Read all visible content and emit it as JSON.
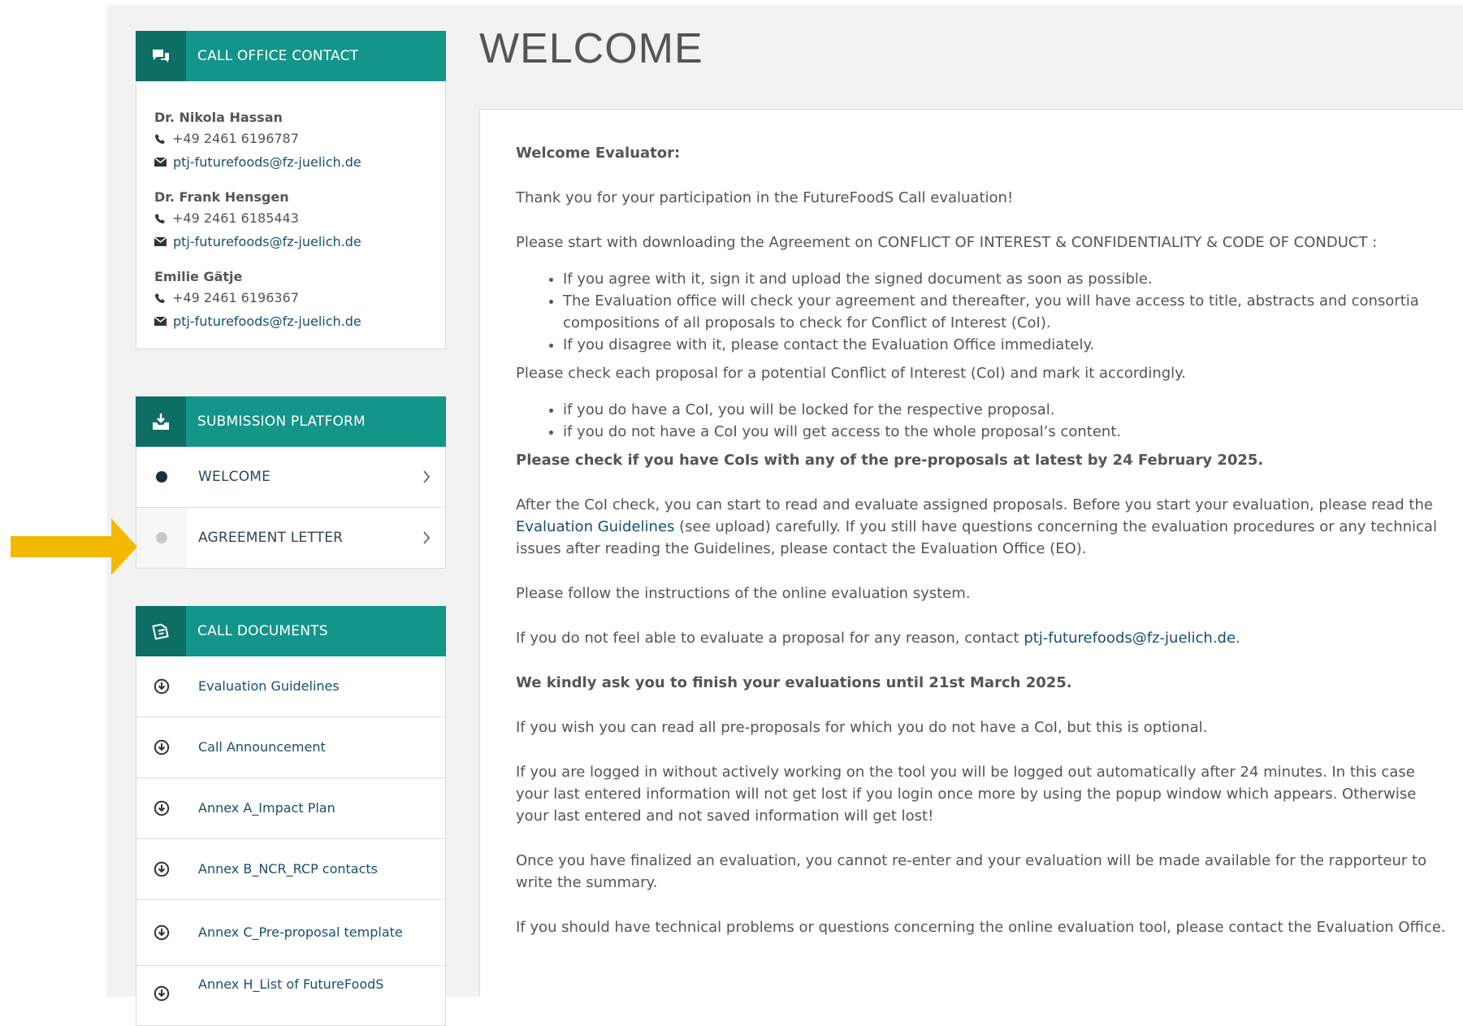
{
  "contact_panel": {
    "title": "CALL OFFICE CONTACT",
    "contacts": [
      {
        "name": "Dr. Nikola Hassan",
        "phone": "+49 2461 6196787",
        "email": "ptj-futurefoods@fz-juelich.de"
      },
      {
        "name": "Dr. Frank Hensgen",
        "phone": "+49 2461 6185443",
        "email": "ptj-futurefoods@fz-juelich.de"
      },
      {
        "name": "Emilie Gätje",
        "phone": "+49 2461 6196367",
        "email": "ptj-futurefoods@fz-juelich.de"
      }
    ]
  },
  "submission_panel": {
    "title": "SUBMISSION PLATFORM",
    "items": [
      {
        "label": "WELCOME",
        "status": "active"
      },
      {
        "label": "AGREEMENT LETTER",
        "status": "inactive"
      }
    ]
  },
  "documents_panel": {
    "title": "CALL DOCUMENTS",
    "items": [
      {
        "label": "Evaluation Guidelines"
      },
      {
        "label": "Call Announcement"
      },
      {
        "label": "Annex A_Impact Plan"
      },
      {
        "label": "Annex B_NCR_RCP contacts"
      },
      {
        "label": "Annex C_Pre-proposal template"
      },
      {
        "label": "Annex H_List of FutureFoodS"
      }
    ]
  },
  "main": {
    "title": "WELCOME",
    "greeting": "Welcome Evaluator:",
    "p1": "Thank you for your participation in the FutureFoodS Call evaluation!",
    "p2": "Please start with downloading the Agreement on CONFLICT OF INTEREST & CONFIDENTIALITY & CODE OF CONDUCT :",
    "list1": [
      "If you agree with it, sign it and upload the signed document as soon as possible.",
      "The Evaluation office will check your agreement and thereafter, you will have access to title, abstracts and consortia compositions of all proposals to check for Conflict of Interest (CoI).",
      "If you disagree with it, please contact the Evaluation Office immediately."
    ],
    "p3": "Please check each proposal for a potential Conflict of Interest (CoI) and mark it accordingly.",
    "list2": [
      "if you do have a CoI, you will be locked for the respective proposal.",
      "if you do not have a CoI you will get access to the whole proposal’s content."
    ],
    "p4_bold": "Please check if you have CoIs with any of the pre-proposals at latest by 24 February 2025.",
    "p5_a": "After the CoI check, you can start to read and evaluate assigned proposals. Before you start your evaluation, please read the ",
    "p5_link": "Evaluation Guidelines",
    "p5_b": " (see upload) carefully. If you still have questions concerning the evaluation procedures or any technical issues after reading the Guidelines, please contact the Evaluation Office (EO).",
    "p6": "Please follow the instructions of the online evaluation system.",
    "p7_a": "If you do not feel able to evaluate a proposal for any reason, contact ",
    "p7_link": "ptj-futurefoods@fz-juelich.de",
    "p7_b": ".",
    "p8_bold": "We kindly ask you to finish your evaluations until 21st March 2025.",
    "p9": "If you wish you can read all pre-proposals for which you do not have a CoI, but this is optional.",
    "p10": "If you are logged in without actively working on the tool you will be logged out automatically after 24 minutes. In this case your last entered information will not get lost if you login once more by using the popup window which appears. Otherwise your last entered and not saved information will get lost!",
    "p11": "Once you have finalized an evaluation, you cannot re-enter and your evaluation will be made available for the rapporteur to write the summary.",
    "p12": "If you should have technical problems or questions concerning the online evaluation tool, please contact the Evaluation Office."
  },
  "colors": {
    "header_teal": "#13958a",
    "header_icon_dark": "#0d6e65",
    "link": "#1a4e6e",
    "arrow": "#f5b800",
    "dot_active": "#1c2e40",
    "dot_inactive": "#c8c8c8"
  }
}
